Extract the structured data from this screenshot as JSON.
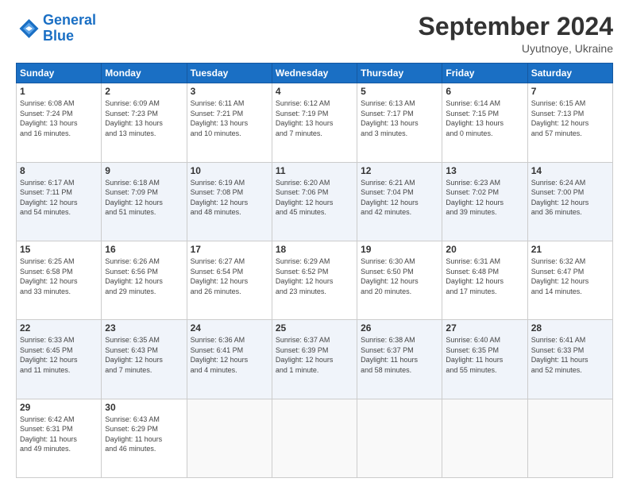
{
  "header": {
    "logo_line1": "General",
    "logo_line2": "Blue",
    "month": "September 2024",
    "location": "Uyutnoye, Ukraine"
  },
  "weekdays": [
    "Sunday",
    "Monday",
    "Tuesday",
    "Wednesday",
    "Thursday",
    "Friday",
    "Saturday"
  ],
  "weeks": [
    [
      {
        "day": "1",
        "info": "Sunrise: 6:08 AM\nSunset: 7:24 PM\nDaylight: 13 hours\nand 16 minutes."
      },
      {
        "day": "2",
        "info": "Sunrise: 6:09 AM\nSunset: 7:23 PM\nDaylight: 13 hours\nand 13 minutes."
      },
      {
        "day": "3",
        "info": "Sunrise: 6:11 AM\nSunset: 7:21 PM\nDaylight: 13 hours\nand 10 minutes."
      },
      {
        "day": "4",
        "info": "Sunrise: 6:12 AM\nSunset: 7:19 PM\nDaylight: 13 hours\nand 7 minutes."
      },
      {
        "day": "5",
        "info": "Sunrise: 6:13 AM\nSunset: 7:17 PM\nDaylight: 13 hours\nand 3 minutes."
      },
      {
        "day": "6",
        "info": "Sunrise: 6:14 AM\nSunset: 7:15 PM\nDaylight: 13 hours\nand 0 minutes."
      },
      {
        "day": "7",
        "info": "Sunrise: 6:15 AM\nSunset: 7:13 PM\nDaylight: 12 hours\nand 57 minutes."
      }
    ],
    [
      {
        "day": "8",
        "info": "Sunrise: 6:17 AM\nSunset: 7:11 PM\nDaylight: 12 hours\nand 54 minutes."
      },
      {
        "day": "9",
        "info": "Sunrise: 6:18 AM\nSunset: 7:09 PM\nDaylight: 12 hours\nand 51 minutes."
      },
      {
        "day": "10",
        "info": "Sunrise: 6:19 AM\nSunset: 7:08 PM\nDaylight: 12 hours\nand 48 minutes."
      },
      {
        "day": "11",
        "info": "Sunrise: 6:20 AM\nSunset: 7:06 PM\nDaylight: 12 hours\nand 45 minutes."
      },
      {
        "day": "12",
        "info": "Sunrise: 6:21 AM\nSunset: 7:04 PM\nDaylight: 12 hours\nand 42 minutes."
      },
      {
        "day": "13",
        "info": "Sunrise: 6:23 AM\nSunset: 7:02 PM\nDaylight: 12 hours\nand 39 minutes."
      },
      {
        "day": "14",
        "info": "Sunrise: 6:24 AM\nSunset: 7:00 PM\nDaylight: 12 hours\nand 36 minutes."
      }
    ],
    [
      {
        "day": "15",
        "info": "Sunrise: 6:25 AM\nSunset: 6:58 PM\nDaylight: 12 hours\nand 33 minutes."
      },
      {
        "day": "16",
        "info": "Sunrise: 6:26 AM\nSunset: 6:56 PM\nDaylight: 12 hours\nand 29 minutes."
      },
      {
        "day": "17",
        "info": "Sunrise: 6:27 AM\nSunset: 6:54 PM\nDaylight: 12 hours\nand 26 minutes."
      },
      {
        "day": "18",
        "info": "Sunrise: 6:29 AM\nSunset: 6:52 PM\nDaylight: 12 hours\nand 23 minutes."
      },
      {
        "day": "19",
        "info": "Sunrise: 6:30 AM\nSunset: 6:50 PM\nDaylight: 12 hours\nand 20 minutes."
      },
      {
        "day": "20",
        "info": "Sunrise: 6:31 AM\nSunset: 6:48 PM\nDaylight: 12 hours\nand 17 minutes."
      },
      {
        "day": "21",
        "info": "Sunrise: 6:32 AM\nSunset: 6:47 PM\nDaylight: 12 hours\nand 14 minutes."
      }
    ],
    [
      {
        "day": "22",
        "info": "Sunrise: 6:33 AM\nSunset: 6:45 PM\nDaylight: 12 hours\nand 11 minutes."
      },
      {
        "day": "23",
        "info": "Sunrise: 6:35 AM\nSunset: 6:43 PM\nDaylight: 12 hours\nand 7 minutes."
      },
      {
        "day": "24",
        "info": "Sunrise: 6:36 AM\nSunset: 6:41 PM\nDaylight: 12 hours\nand 4 minutes."
      },
      {
        "day": "25",
        "info": "Sunrise: 6:37 AM\nSunset: 6:39 PM\nDaylight: 12 hours\nand 1 minute."
      },
      {
        "day": "26",
        "info": "Sunrise: 6:38 AM\nSunset: 6:37 PM\nDaylight: 11 hours\nand 58 minutes."
      },
      {
        "day": "27",
        "info": "Sunrise: 6:40 AM\nSunset: 6:35 PM\nDaylight: 11 hours\nand 55 minutes."
      },
      {
        "day": "28",
        "info": "Sunrise: 6:41 AM\nSunset: 6:33 PM\nDaylight: 11 hours\nand 52 minutes."
      }
    ],
    [
      {
        "day": "29",
        "info": "Sunrise: 6:42 AM\nSunset: 6:31 PM\nDaylight: 11 hours\nand 49 minutes."
      },
      {
        "day": "30",
        "info": "Sunrise: 6:43 AM\nSunset: 6:29 PM\nDaylight: 11 hours\nand 46 minutes."
      },
      {
        "day": "",
        "info": ""
      },
      {
        "day": "",
        "info": ""
      },
      {
        "day": "",
        "info": ""
      },
      {
        "day": "",
        "info": ""
      },
      {
        "day": "",
        "info": ""
      }
    ]
  ]
}
